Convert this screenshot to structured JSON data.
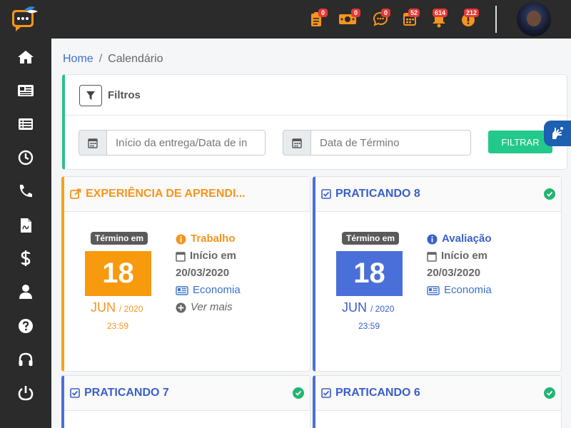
{
  "notifications": [
    {
      "icon": "clipboard-icon",
      "count": "0"
    },
    {
      "icon": "money-icon",
      "count": "0"
    },
    {
      "icon": "chat-icon",
      "count": "0"
    },
    {
      "icon": "calendar-icon",
      "count": "52"
    },
    {
      "icon": "bell-icon",
      "count": "614"
    },
    {
      "icon": "alert-icon",
      "count": "212"
    }
  ],
  "sidebar": {
    "items": [
      "home-icon",
      "newspaper-icon",
      "list-icon",
      "clock-icon",
      "phone-icon",
      "document-icon",
      "dollar-icon",
      "user-icon",
      "help-icon",
      "headphones-icon",
      "power-icon"
    ]
  },
  "breadcrumb": {
    "home": "Home",
    "sep": "/",
    "current": "Calendário"
  },
  "filters": {
    "title": "Filtros",
    "start_placeholder": "Início da entrega/Data de in",
    "end_placeholder": "Data de Término",
    "button": "FILTRAR"
  },
  "colors": {
    "orange": "#f7a11a",
    "blue": "#4a6fd8",
    "green": "#22c98b"
  },
  "cards": [
    {
      "title": "EXPERIÊNCIA DE APRENDI...",
      "termino": "Término em",
      "day": "18",
      "month": "JUN",
      "year": "/ 2020",
      "time": "23:59",
      "type": "Trabalho",
      "start_label": "Início em",
      "start_date": "20/03/2020",
      "subject": "Economia",
      "more": "Ver mais"
    },
    {
      "title": "PRATICANDO 8",
      "termino": "Término em",
      "day": "18",
      "month": "JUN",
      "year": "/ 2020",
      "time": "23:59",
      "type": "Avaliação",
      "start_label": "Início em",
      "start_date": "20/03/2020",
      "subject": "Economia"
    },
    {
      "title": "PRATICANDO 7"
    },
    {
      "title": "PRATICANDO 6"
    }
  ]
}
